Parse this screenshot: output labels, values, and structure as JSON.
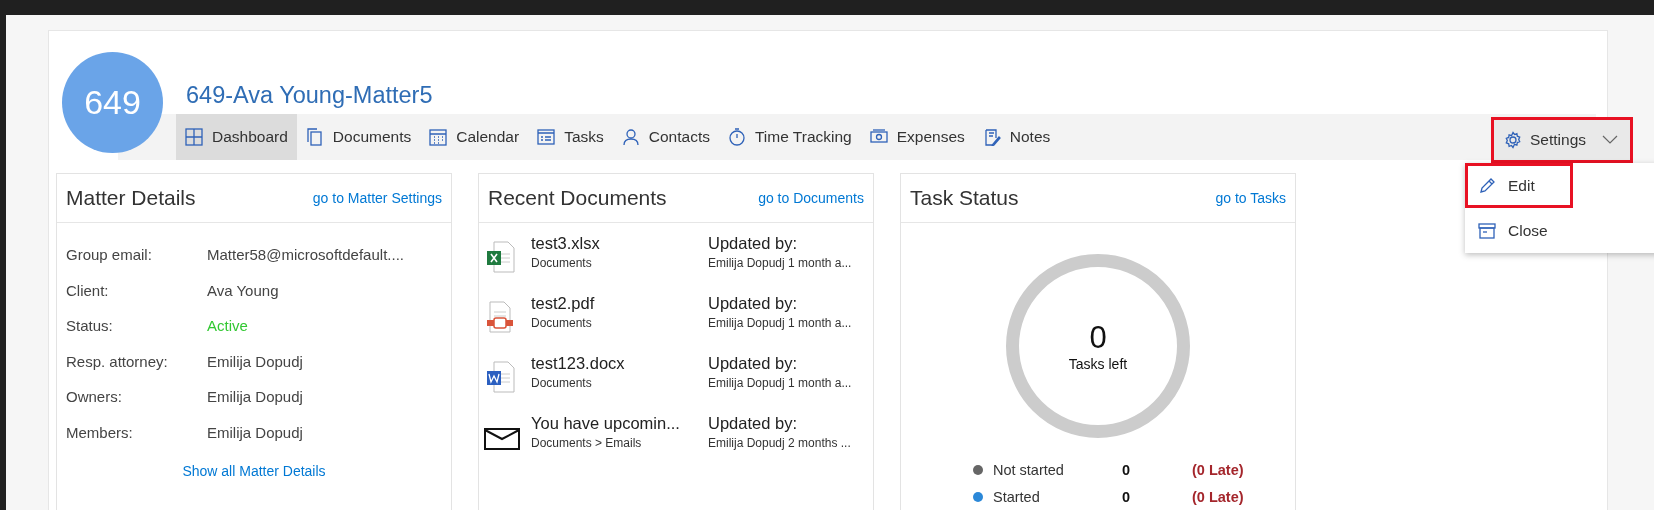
{
  "matter": {
    "avatar": "649",
    "title": "649-Ava Young-Matter5"
  },
  "nav": [
    {
      "label": "Dashboard",
      "selected": true
    },
    {
      "label": "Documents",
      "selected": false
    },
    {
      "label": "Calendar",
      "selected": false
    },
    {
      "label": "Tasks",
      "selected": false
    },
    {
      "label": "Contacts",
      "selected": false
    },
    {
      "label": "Time Tracking",
      "selected": false
    },
    {
      "label": "Expenses",
      "selected": false
    },
    {
      "label": "Notes",
      "selected": false
    }
  ],
  "settings": {
    "label": "Settings",
    "highlighted": true,
    "expanded": true,
    "menu": [
      {
        "label": "Edit",
        "highlighted": true
      },
      {
        "label": "Close",
        "highlighted": false
      }
    ]
  },
  "matter_details": {
    "title": "Matter Details",
    "link": "go to Matter Settings",
    "rows": [
      {
        "label": "Group email:",
        "value": "Matter58@microsoftdefault....",
        "kind": "text"
      },
      {
        "label": "Client:",
        "value": "Ava Young",
        "kind": "text"
      },
      {
        "label": "Status:",
        "value": "Active",
        "kind": "status"
      },
      {
        "label": "Resp. attorney:",
        "value": "Emilija Dopudj",
        "kind": "text"
      },
      {
        "label": "Owners:",
        "value": "Emilija Dopudj",
        "kind": "text"
      },
      {
        "label": "Members:",
        "value": "Emilija Dopudj",
        "kind": "text"
      }
    ],
    "footer_link": "Show all Matter Details"
  },
  "recent_documents": {
    "title": "Recent Documents",
    "link": "go to Documents",
    "items": [
      {
        "kind": "excel",
        "name": "test3.xlsx",
        "location": "Documents",
        "updated_label": "Updated by:",
        "updated_by": "Emilija Dopudj 1 month a..."
      },
      {
        "kind": "pdf",
        "name": "test2.pdf",
        "location": "Documents",
        "updated_label": "Updated by:",
        "updated_by": "Emilija Dopudj 1 month a..."
      },
      {
        "kind": "word",
        "name": "test123.docx",
        "location": "Documents",
        "updated_label": "Updated by:",
        "updated_by": "Emilija Dopudj 1 month a..."
      },
      {
        "kind": "email",
        "name": "You have upcomin...",
        "location": "Documents > Emails",
        "updated_label": "Updated by:",
        "updated_by": "Emilija Dopudj 2 months ..."
      }
    ]
  },
  "task_status": {
    "title": "Task Status",
    "link": "go to Tasks",
    "count": "0",
    "count_label": "Tasks left",
    "legend": [
      {
        "label": "Not started",
        "color": "#666666",
        "count": "0",
        "late": "(0 Late)"
      },
      {
        "label": "Started",
        "color": "#2b88d8",
        "count": "0",
        "late": "(0 Late)"
      }
    ]
  }
}
